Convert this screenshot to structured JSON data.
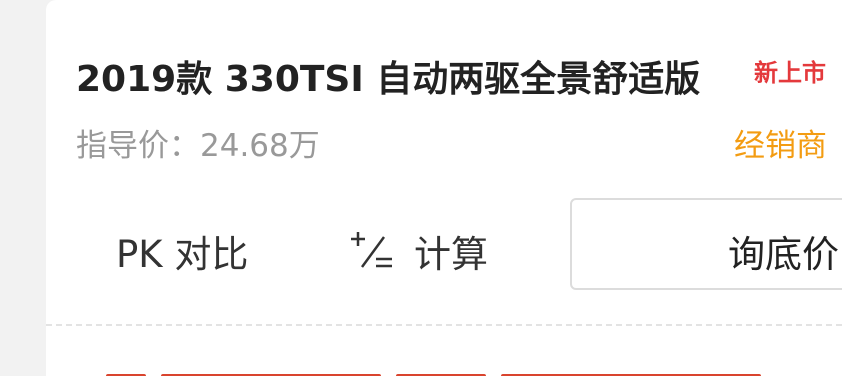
{
  "car": {
    "title": "2019款 330TSI 自动两驱全景舒适版",
    "badge": "新上市",
    "guide_price": "指导价：24.68万",
    "dealer_label": "经销商"
  },
  "actions": {
    "pk_label": "PK 对比",
    "calc_label": "计算",
    "inquiry_label": "询底价"
  },
  "icons": {
    "calculator": "plus-minus-equals-icon"
  },
  "colors": {
    "title": "#222222",
    "badge": "#e4393c",
    "guide_price": "#999999",
    "dealer": "#f39c12",
    "button_border": "#dcdcdc",
    "peek_text": "#d9442e"
  }
}
